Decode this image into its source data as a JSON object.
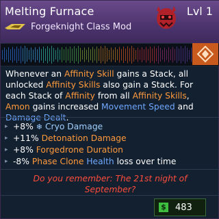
{
  "item": {
    "name": "Melting Furnace",
    "level": "Lvl 1",
    "type": "Forgeknight Class Mod"
  },
  "description": {
    "p1": "Whenever an ",
    "k1": "Affinity Skill",
    "p2": " gains a Stack, all unlocked ",
    "k2": "Affinity Skills",
    "p3": " also gain a Stack. For each Stack of ",
    "k3": "Affinity",
    "p4": " from all ",
    "k4": "Affinity Skills",
    "p5": ", ",
    "k5": "Amon",
    "p6": " gains increased ",
    "k6": "Movement Speed",
    "p7": " and ",
    "k7": "Damage Dealt",
    "p8": "."
  },
  "stats": [
    {
      "value": "+8%",
      "icon": "snowflake-icon",
      "label": "Cryo Damage"
    },
    {
      "value": "+11%",
      "label": "Detonation Damage"
    },
    {
      "value": "+8%",
      "label": "Forgedrone Duration"
    },
    {
      "value": "-8%",
      "label1": "Phase Clone",
      "label2": "Health",
      "label3": "loss over time"
    }
  ],
  "flavor_text": "Do you remember: The 21st night of September?",
  "price": {
    "icon": "$",
    "value": "483"
  },
  "colors": {
    "header_purple": "#5a3d7c",
    "keyword_orange": "#ff9a3c",
    "keyword_blue": "#6fa8ff",
    "flavor_red": "#ff4d3d",
    "price_green": "#3fbf3f"
  }
}
